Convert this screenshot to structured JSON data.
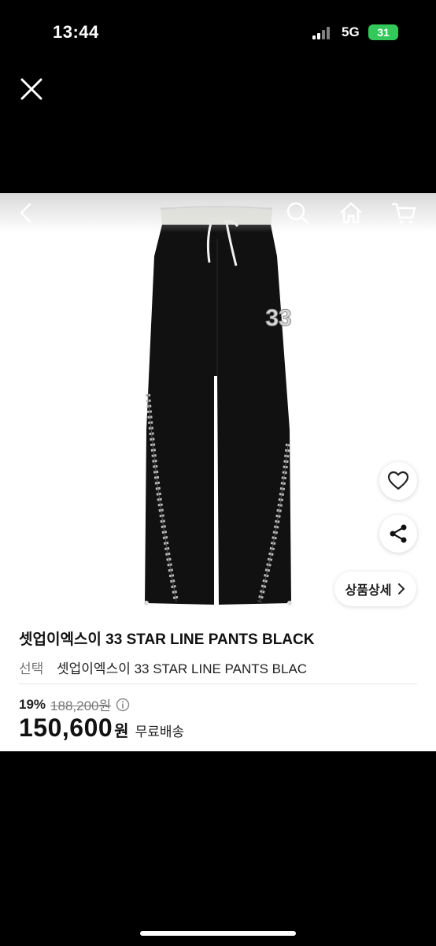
{
  "status_bar": {
    "time": "13:44",
    "network": "5G",
    "battery": "31"
  },
  "icons": {
    "close": "close-icon",
    "back": "chevron-left-icon",
    "search": "search-icon",
    "home": "home-icon",
    "cart": "cart-icon",
    "wishlist": "heart-icon",
    "share": "share-icon",
    "detail": "chevron-right-icon",
    "info": "info-icon"
  },
  "product": {
    "jersey_number": "33",
    "detail_label": "상품상세",
    "title": "셋업이엑스이 33 STAR LINE PANTS BLACK",
    "option_label": "선택",
    "option_value": "셋업이엑스이 33 STAR LINE PANTS BLAC",
    "discount": "19%",
    "original_price": "188,200원",
    "price": "150,600",
    "currency": "원",
    "shipping": "무료배송"
  },
  "colors": {
    "battery": "#34c759",
    "pants": "#111111"
  }
}
